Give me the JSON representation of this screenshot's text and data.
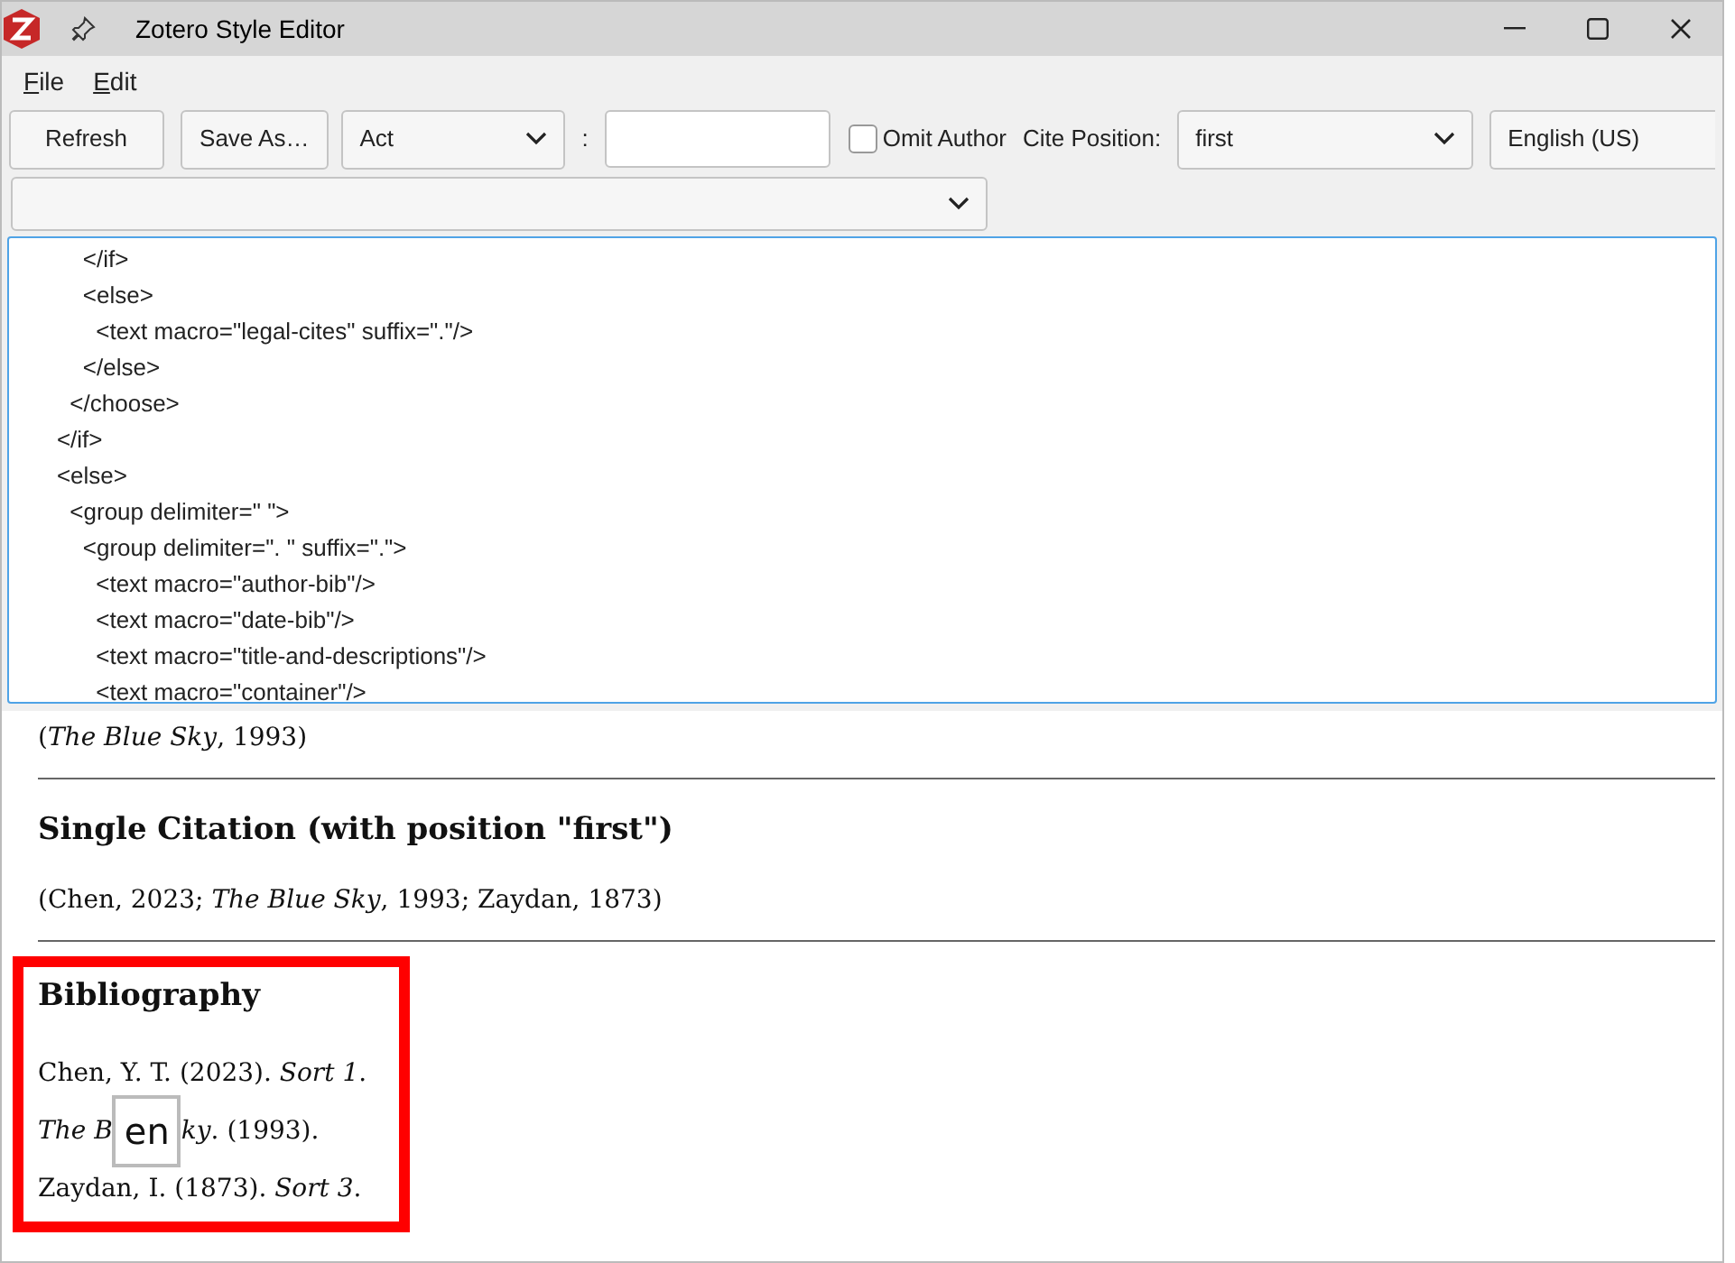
{
  "window": {
    "title": "Zotero Style Editor"
  },
  "menu": [
    {
      "label": "File"
    },
    {
      "label": "Edit"
    }
  ],
  "toolbar": {
    "refresh": "Refresh",
    "save_as": "Save As…",
    "locator_select": "Act",
    "separator": ":",
    "omit_author": {
      "label": "Omit Author",
      "checked": false
    },
    "cite_position_label": "Cite Position:",
    "cite_position": "first",
    "locale": "English (US)"
  },
  "code_lines": [
    "        </if>",
    "        <else>",
    "          <text macro=\"legal-cites\" suffix=\".\"/>",
    "        </else>",
    "      </choose>",
    "    </if>",
    "    <else>",
    "      <group delimiter=\" \">",
    "        <group delimiter=\". \" suffix=\".\">",
    "          <text macro=\"author-bib\"/>",
    "          <text macro=\"date-bib\"/>",
    "          <text macro=\"title-and-descriptions\"/>",
    "          <text macro=\"container\"/>"
  ],
  "preview": [
    {
      "kind": "citation",
      "text": "(*The Blue Sky*, 1993)"
    },
    {
      "kind": "rule"
    },
    {
      "kind": "heading",
      "text": "Single Citation (with position \"first\")"
    },
    {
      "kind": "citation",
      "text": "(Chen, 2023; *The Blue Sky*, 1993; Zaydan, 1873)"
    },
    {
      "kind": "rule"
    }
  ],
  "bibliography": {
    "heading": "Bibliography",
    "entries": [
      {
        "text": "Chen, Y. T. (2023). *Sort 1*."
      },
      {
        "text_before": "*The B*",
        "ime_hint": "en",
        "text_after": "*ky*. (1993)."
      },
      {
        "text": "Zaydan, I. (1873). *Sort 3*."
      }
    ]
  }
}
